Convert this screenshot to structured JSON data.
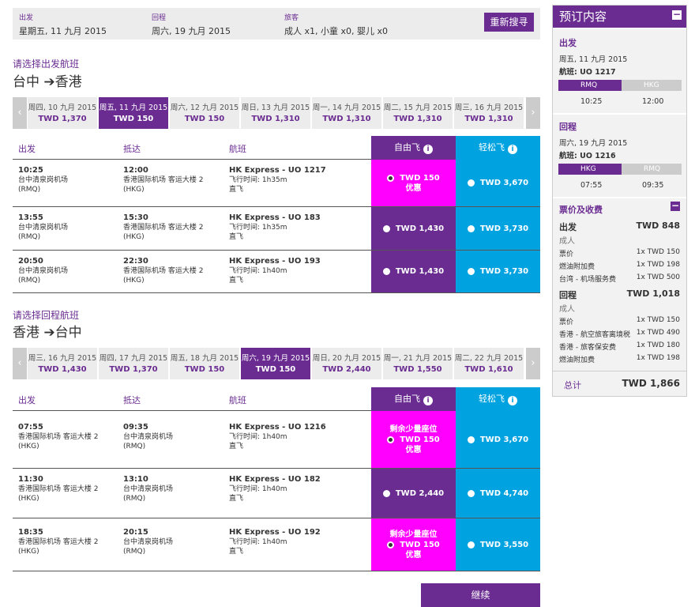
{
  "search": {
    "depart_label": "出发",
    "depart_value": "星期五, 11 九月 2015",
    "return_label": "回程",
    "return_value": "周六, 19 九月 2015",
    "pax_label": "旅客",
    "pax_value": "成人 x1, 小童 x0, 婴儿 x0",
    "research_label": "重新搜寻"
  },
  "outbound": {
    "title": "请选择出发航班",
    "from": "台中",
    "to": "香港",
    "arrow": "➔",
    "dates": [
      {
        "date": "周四, 10 九月 2015",
        "price": "TWD 1,370"
      },
      {
        "date": "周五, 11 九月 2015",
        "price": "TWD 150",
        "selected": true
      },
      {
        "date": "周六, 12 九月 2015",
        "price": "TWD 150"
      },
      {
        "date": "周日, 13 九月 2015",
        "price": "TWD 1,310"
      },
      {
        "date": "周一, 14 九月 2015",
        "price": "TWD 1,310"
      },
      {
        "date": "周二, 15 九月 2015",
        "price": "TWD 1,310"
      },
      {
        "date": "周三, 16 九月 2015",
        "price": "TWD 1,310"
      }
    ],
    "flights": [
      {
        "dep_time": "10:25",
        "dep_airport": "台中清泉岗机场",
        "dep_code": "(RMQ)",
        "arr_time": "12:00",
        "arr_airport": "香港国际机场 客运大楼 2",
        "arr_code": "(HKG)",
        "flight": "HK Express - UO 1217",
        "duration": "飞行时间: 1h35m",
        "stops": "直飞",
        "fare1": "TWD 150",
        "fare1_note": "优惠",
        "fare2": "TWD 3,670"
      },
      {
        "dep_time": "13:55",
        "dep_airport": "台中清泉岗机场",
        "dep_code": "(RMQ)",
        "arr_time": "15:30",
        "arr_airport": "香港国际机场 客运大楼 2",
        "arr_code": "(HKG)",
        "flight": "HK Express - UO 183",
        "duration": "飞行时间: 1h35m",
        "stops": "直飞",
        "fare1": "TWD 1,430",
        "fare2": "TWD 3,730"
      },
      {
        "dep_time": "20:50",
        "dep_airport": "台中清泉岗机场",
        "dep_code": "(RMQ)",
        "arr_time": "22:30",
        "arr_airport": "香港国际机场 客运大楼 2",
        "arr_code": "(HKG)",
        "flight": "HK Express - UO 193",
        "duration": "飞行时间: 1h40m",
        "stops": "直飞",
        "fare1": "TWD 1,430",
        "fare2": "TWD 3,730"
      }
    ]
  },
  "inbound": {
    "title": "请选择回程航班",
    "from": "香港",
    "to": "台中",
    "arrow": "➔",
    "dates": [
      {
        "date": "周三, 16 九月 2015",
        "price": "TWD 1,430"
      },
      {
        "date": "周四, 17 九月 2015",
        "price": "TWD 1,370"
      },
      {
        "date": "周五, 18 九月 2015",
        "price": "TWD 150"
      },
      {
        "date": "周六, 19 九月 2015",
        "price": "TWD 150",
        "selected": true
      },
      {
        "date": "周日, 20 九月 2015",
        "price": "TWD 2,440"
      },
      {
        "date": "周一, 21 九月 2015",
        "price": "TWD 1,550"
      },
      {
        "date": "周二, 22 九月 2015",
        "price": "TWD 1,610"
      }
    ],
    "flights": [
      {
        "dep_time": "07:55",
        "dep_airport": "香港国际机场 客运大楼 2",
        "dep_code": "(HKG)",
        "arr_time": "09:35",
        "arr_airport": "台中清泉岗机场",
        "arr_code": "(RMQ)",
        "flight": "HK Express - UO 1216",
        "duration": "飞行时间: 1h40m",
        "stops": "直飞",
        "fare1_top": "剩余少量座位",
        "fare1": "TWD 150",
        "fare1_note": "优惠",
        "fare2": "TWD 3,670"
      },
      {
        "dep_time": "11:30",
        "dep_airport": "香港国际机场 客运大楼 2",
        "dep_code": "(HKG)",
        "arr_time": "13:10",
        "arr_airport": "台中清泉岗机场",
        "arr_code": "(RMQ)",
        "flight": "HK Express - UO 182",
        "duration": "飞行时间: 1h40m",
        "stops": "直飞",
        "fare1": "TWD 2,440",
        "fare2": "TWD 4,740"
      },
      {
        "dep_time": "18:35",
        "dep_airport": "香港国际机场 客运大楼 2",
        "dep_code": "(HKG)",
        "arr_time": "20:15",
        "arr_airport": "台中清泉岗机场",
        "arr_code": "(RMQ)",
        "flight": "HK Express - UO 192",
        "duration": "飞行时间: 1h40m",
        "stops": "直飞",
        "fare1_top": "剩余少量座位",
        "fare1": "TWD 150",
        "fare1_note": "优惠",
        "fare2": "TWD 3,550"
      }
    ]
  },
  "table_headers": {
    "depart": "出发",
    "arrive": "抵达",
    "flight": "航班",
    "fare1": "自由飞",
    "fare2": "轻松飞",
    "info": "i"
  },
  "continue_label": "继续",
  "summary": {
    "title": "预订内容",
    "collapse": "−",
    "out": {
      "title": "出发",
      "date": "周五, 11 九月 2015",
      "flight": "航班: UO 1217",
      "from": "RMQ",
      "to": "HKG",
      "dep": "10:25",
      "arr": "12:00"
    },
    "ret": {
      "title": "回程",
      "date": "周六, 19 九月 2015",
      "flight": "航班: UO 1216",
      "from": "HKG",
      "to": "RMQ",
      "dep": "07:55",
      "arr": "09:35"
    },
    "fees_title": "票价及收费",
    "out_fees": {
      "label": "出发",
      "total": "TWD 848",
      "pax": "成人",
      "items": [
        {
          "name": "票价",
          "value": "1x TWD 150"
        },
        {
          "name": "燃油附加费",
          "value": "1x TWD 198"
        },
        {
          "name": "台湾 - 机场服务费",
          "value": "1x TWD 500"
        }
      ]
    },
    "ret_fees": {
      "label": "回程",
      "total": "TWD 1,018",
      "pax": "成人",
      "items": [
        {
          "name": "票价",
          "value": "1x TWD 150"
        },
        {
          "name": "香港 - 航空旅客离境税",
          "value": "1x TWD 490"
        },
        {
          "name": "香港 - 旅客保安费",
          "value": "1x TWD 180"
        },
        {
          "name": "燃油附加费",
          "value": "1x TWD 198"
        }
      ]
    },
    "total_label": "总计",
    "total_value": "TWD 1,866"
  }
}
